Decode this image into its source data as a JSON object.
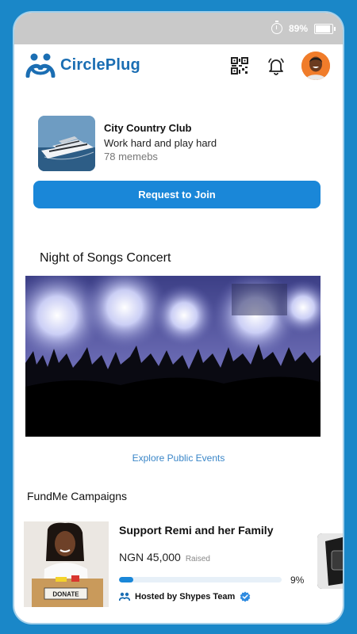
{
  "status": {
    "battery_text": "89%",
    "battery_level": 0.89
  },
  "app": {
    "name": "CirclePlug",
    "brand_color": "#1b6eb3",
    "accent_color": "#1a87d8",
    "frame_color": "#1a87c8"
  },
  "appbar": {
    "qr_icon": "qr-code-icon",
    "bell_icon": "bell-icon",
    "avatar_icon": "user-avatar"
  },
  "club": {
    "name": "City Country Club",
    "tagline": "Work hard and play hard",
    "members": "78 memebs",
    "join_label": "Request to Join"
  },
  "event": {
    "title": "Night of Songs Concert",
    "explore_label": "Explore Public Events"
  },
  "fundme": {
    "section_title": "FundMe Campaigns",
    "campaign": {
      "title": "Support Remi and her Family",
      "amount": "NGN 45,000",
      "raised_label": "Raised",
      "progress_percent": "9%",
      "progress": 0.09,
      "hosted_by": "Hosted by Shypes Team",
      "donate_text": "DONATE"
    }
  }
}
